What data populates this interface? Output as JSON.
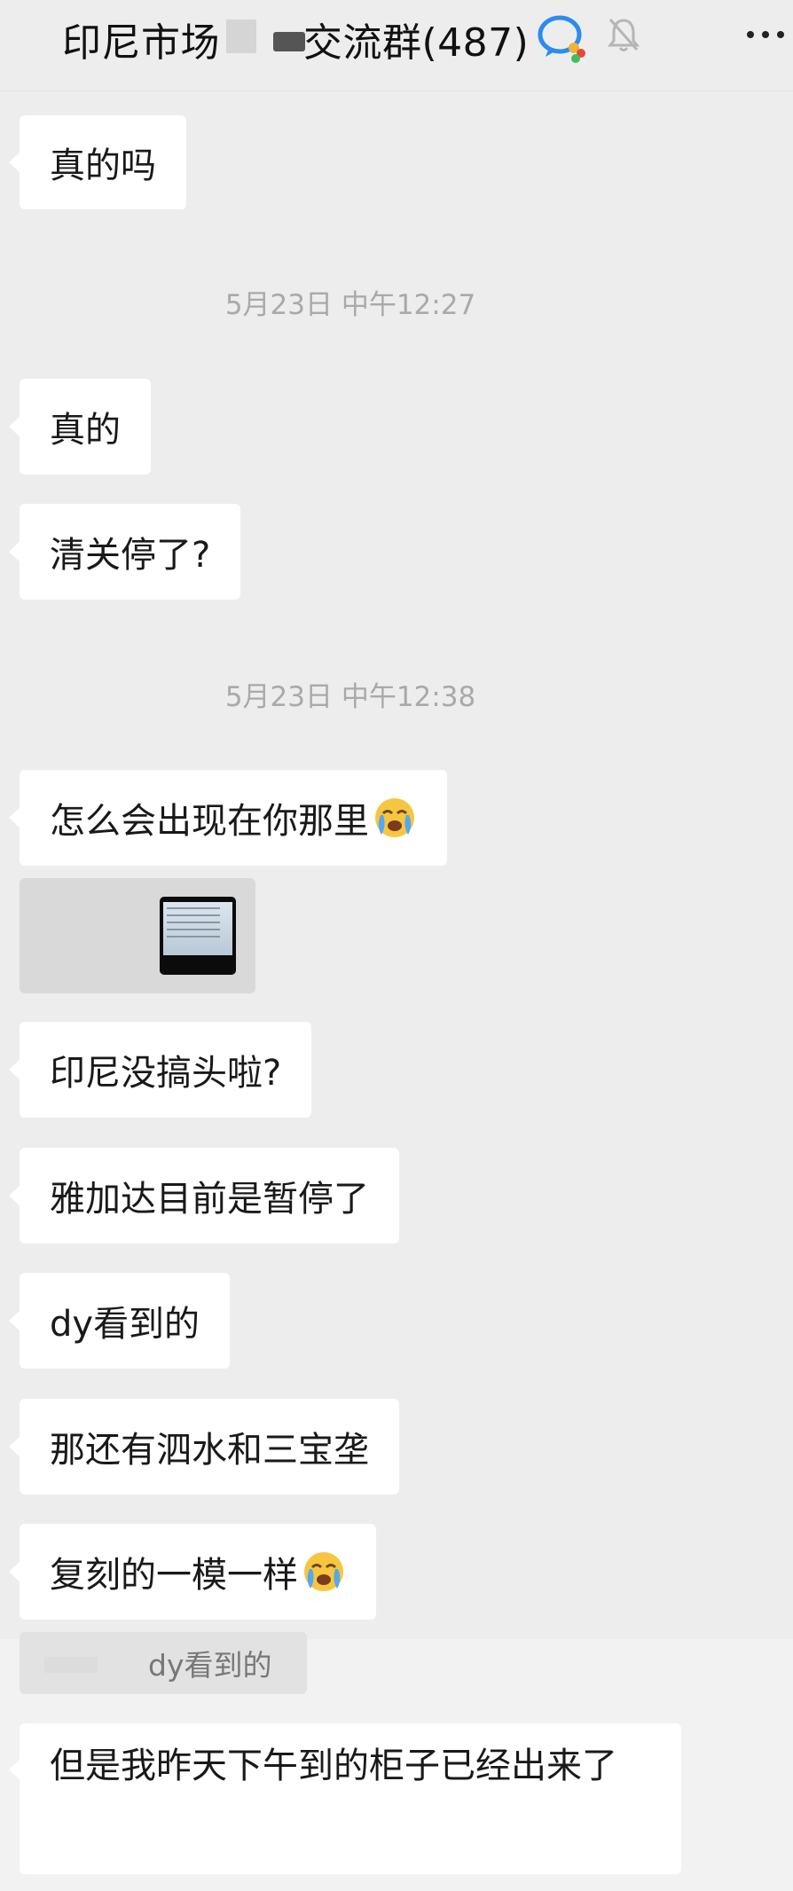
{
  "header": {
    "title_prefix": "印尼市场",
    "title_suffix": "交流群(487)"
  },
  "messages": [
    {
      "type": "text",
      "text": "真的吗"
    },
    {
      "type": "time",
      "text": "5月23日 中午12:27"
    },
    {
      "type": "text",
      "text": "真的"
    },
    {
      "type": "text",
      "text": "清关停了?"
    },
    {
      "type": "time",
      "text": "5月23日 中午12:38"
    },
    {
      "type": "text",
      "text": "怎么会出现在你那里",
      "emoji": "crying-face"
    },
    {
      "type": "image"
    },
    {
      "type": "text",
      "text": "印尼没搞头啦?"
    },
    {
      "type": "text",
      "text": "雅加达目前是暂停了"
    },
    {
      "type": "text",
      "text": "dy看到的"
    },
    {
      "type": "text",
      "text": "那还有泗水和三宝垄"
    },
    {
      "type": "text",
      "text": "复刻的一模一样",
      "emoji": "crying-face"
    },
    {
      "type": "quote",
      "text": "dy看到的"
    },
    {
      "type": "text",
      "text": "但是我昨天下午到的柜子已经出来了"
    }
  ]
}
